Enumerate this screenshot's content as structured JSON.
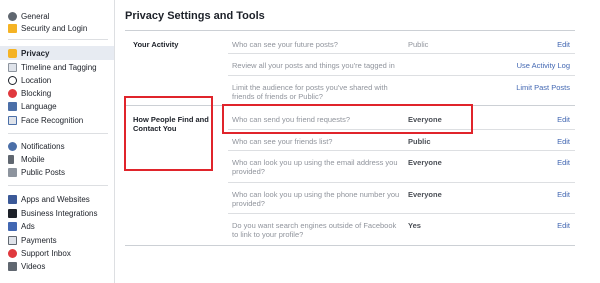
{
  "sidebar": {
    "items": [
      {
        "label": "General",
        "icon": "gear-icon"
      },
      {
        "label": "Security and Login",
        "icon": "shield-icon"
      },
      {
        "label": "Privacy",
        "icon": "lock-icon"
      },
      {
        "label": "Timeline and Tagging",
        "icon": "timeline-icon"
      },
      {
        "label": "Location",
        "icon": "location-icon"
      },
      {
        "label": "Blocking",
        "icon": "block-icon"
      },
      {
        "label": "Language",
        "icon": "language-icon"
      },
      {
        "label": "Face Recognition",
        "icon": "face-recognition-icon"
      },
      {
        "label": "Notifications",
        "icon": "globe-icon"
      },
      {
        "label": "Mobile",
        "icon": "mobile-icon"
      },
      {
        "label": "Public Posts",
        "icon": "public-posts-icon"
      },
      {
        "label": "Apps and Websites",
        "icon": "apps-icon"
      },
      {
        "label": "Business Integrations",
        "icon": "business-icon"
      },
      {
        "label": "Ads",
        "icon": "ads-icon"
      },
      {
        "label": "Payments",
        "icon": "payments-icon"
      },
      {
        "label": "Support Inbox",
        "icon": "support-icon"
      },
      {
        "label": "Videos",
        "icon": "videos-icon"
      }
    ],
    "active": "Privacy"
  },
  "main": {
    "title": "Privacy Settings and Tools",
    "sections": [
      {
        "label": "Your Activity",
        "rows": [
          {
            "question": "Who can see your future posts?",
            "value": "Public",
            "action": "Edit"
          },
          {
            "question": "Review all your posts and things you're tagged in",
            "value": "",
            "action": "Use Activity Log"
          },
          {
            "question": "Limit the audience for posts you've shared with friends of friends or Public?",
            "value": "",
            "action": "Limit Past Posts"
          }
        ]
      },
      {
        "label": "How People Find and Contact You",
        "rows": [
          {
            "question": "Who can send you friend requests?",
            "value": "Everyone",
            "action": "Edit"
          },
          {
            "question": "Who can see your friends list?",
            "value": "Public",
            "action": "Edit"
          },
          {
            "question": "Who can look you up using the email address you provided?",
            "value": "Everyone",
            "action": "Edit"
          },
          {
            "question": "Who can look you up using the phone number you provided?",
            "value": "Everyone",
            "action": "Edit"
          },
          {
            "question": "Do you want search engines outside of Facebook to link to your profile?",
            "value": "Yes",
            "action": "Edit"
          }
        ]
      }
    ]
  },
  "colors": {
    "link": "#4267b2",
    "highlight": "#e0242b",
    "active_bg": "#e7ebf2"
  }
}
